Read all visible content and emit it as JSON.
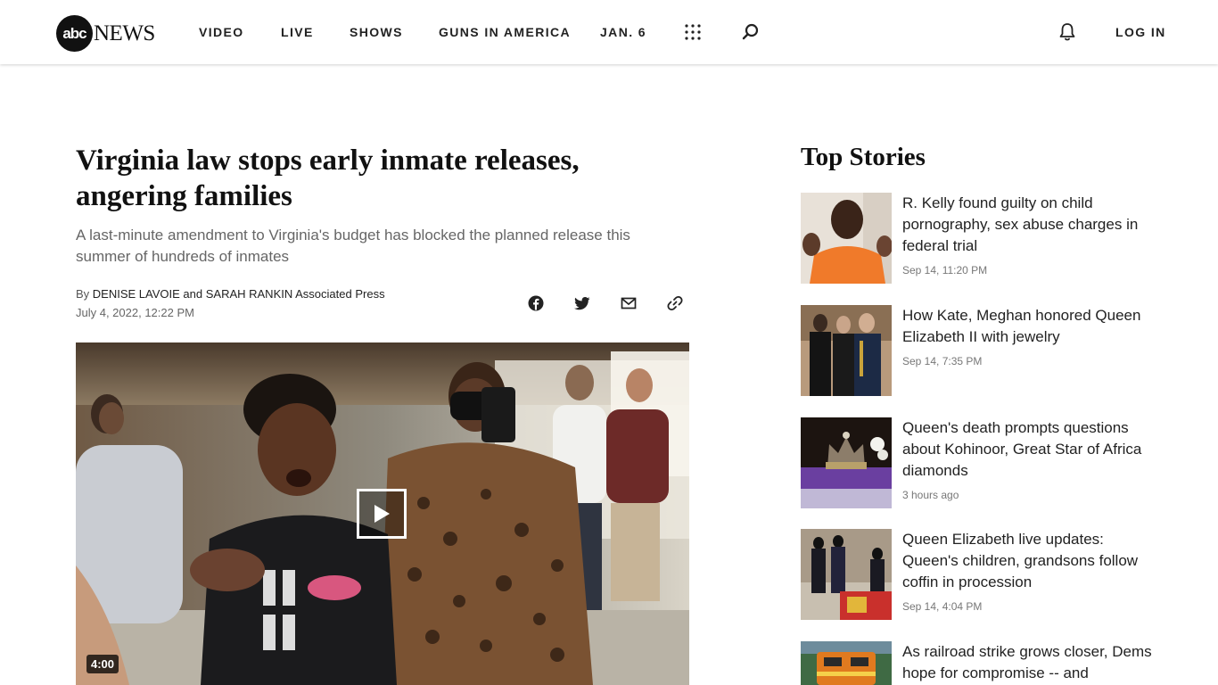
{
  "header": {
    "logo_badge": "abc",
    "logo_word": "NEWS",
    "nav": [
      "VIDEO",
      "LIVE",
      "SHOWS",
      "GUNS IN AMERICA",
      "JAN. 6"
    ],
    "login": "LOG IN",
    "icons": [
      "apps-grid-icon",
      "search-icon",
      "bell-icon"
    ]
  },
  "article": {
    "headline": "Virginia law stops early inmate releases, angering families",
    "dek": "A last-minute amendment to Virginia's budget has blocked the planned release this summer of hundreds of inmates",
    "byline_prefix": "By ",
    "byline_authors": "DENISE LAVOIE and SARAH RANKIN Associated Press",
    "date": "July 4, 2022, 12:22 PM",
    "share_icons": [
      "facebook-icon",
      "twitter-icon",
      "email-icon",
      "link-icon"
    ],
    "video_duration": "4:00"
  },
  "top_stories": {
    "title": "Top Stories",
    "items": [
      {
        "title": "R. Kelly found guilty on child pornography, sex abuse charges in federal trial",
        "time": "Sep 14, 11:20 PM"
      },
      {
        "title": "How Kate, Meghan honored Queen Elizabeth II with jewelry",
        "time": "Sep 14, 7:35 PM"
      },
      {
        "title": "Queen's death prompts questions about Kohinoor, Great Star of Africa diamonds",
        "time": "3 hours ago"
      },
      {
        "title": "Queen Elizabeth live updates: Queen's children, grandsons follow coffin in procession",
        "time": "Sep 14, 4:04 PM"
      },
      {
        "title": "As railroad strike grows closer, Dems hope for compromise -- and",
        "time": ""
      }
    ]
  },
  "colors": {
    "text": "#1a1a1a",
    "muted": "#666666",
    "logo": "#111111"
  }
}
